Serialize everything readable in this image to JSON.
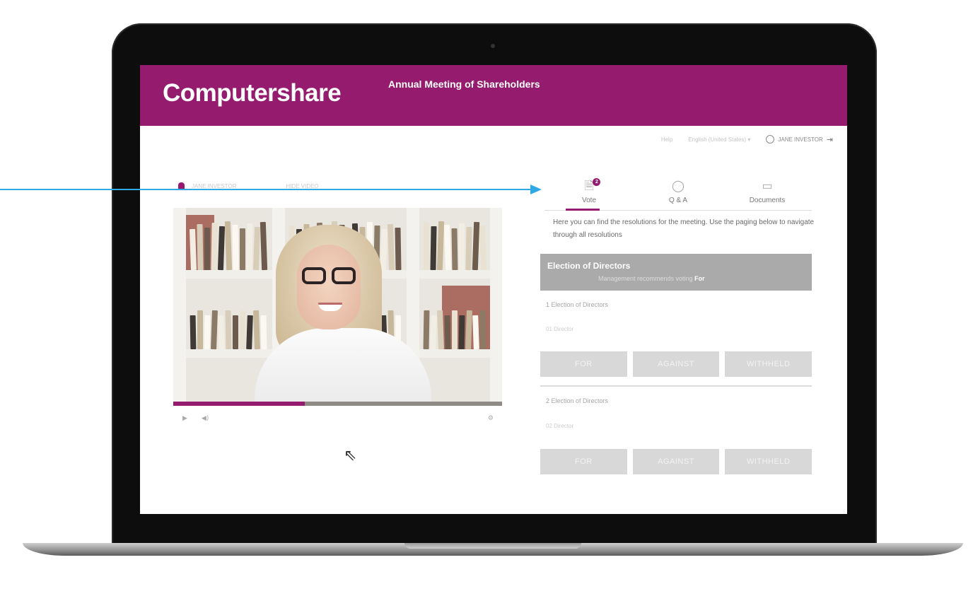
{
  "header": {
    "brand": "Computershare",
    "meeting_title": "Annual Meeting of Shareholders"
  },
  "util_bar": {
    "help": "Help",
    "language": "English (United States)",
    "user": "JANE INVESTOR"
  },
  "video_panel": {
    "presenter": "JANE INVESTOR",
    "hide_video": "HIDE VIDEO",
    "progress": 0.4
  },
  "tabs": [
    {
      "label": "Vote",
      "icon": "document-icon",
      "badge": "2"
    },
    {
      "label": "Q & A",
      "icon": "chat-bubble-icon"
    },
    {
      "label": "Documents",
      "icon": "folder-icon"
    }
  ],
  "vote": {
    "intro": "Here you can find the resolutions for the meeting. Use the paging below to navigate through all resolutions",
    "section_title": "Election of Directors",
    "recommendation_prefix": "Management recommends voting",
    "recommendation_value": "For",
    "items": [
      {
        "label": "1 Election of Directors",
        "sub": "01 Director",
        "buttons": [
          "FOR",
          "AGAINST",
          "WITHHELD"
        ]
      },
      {
        "label": "2 Election of Directors",
        "sub": "02 Director",
        "buttons": [
          "FOR",
          "AGAINST",
          "WITHHELD"
        ]
      }
    ]
  },
  "colors": {
    "brand": "#951b6e",
    "annotation_arrow": "#2fa8e6"
  }
}
